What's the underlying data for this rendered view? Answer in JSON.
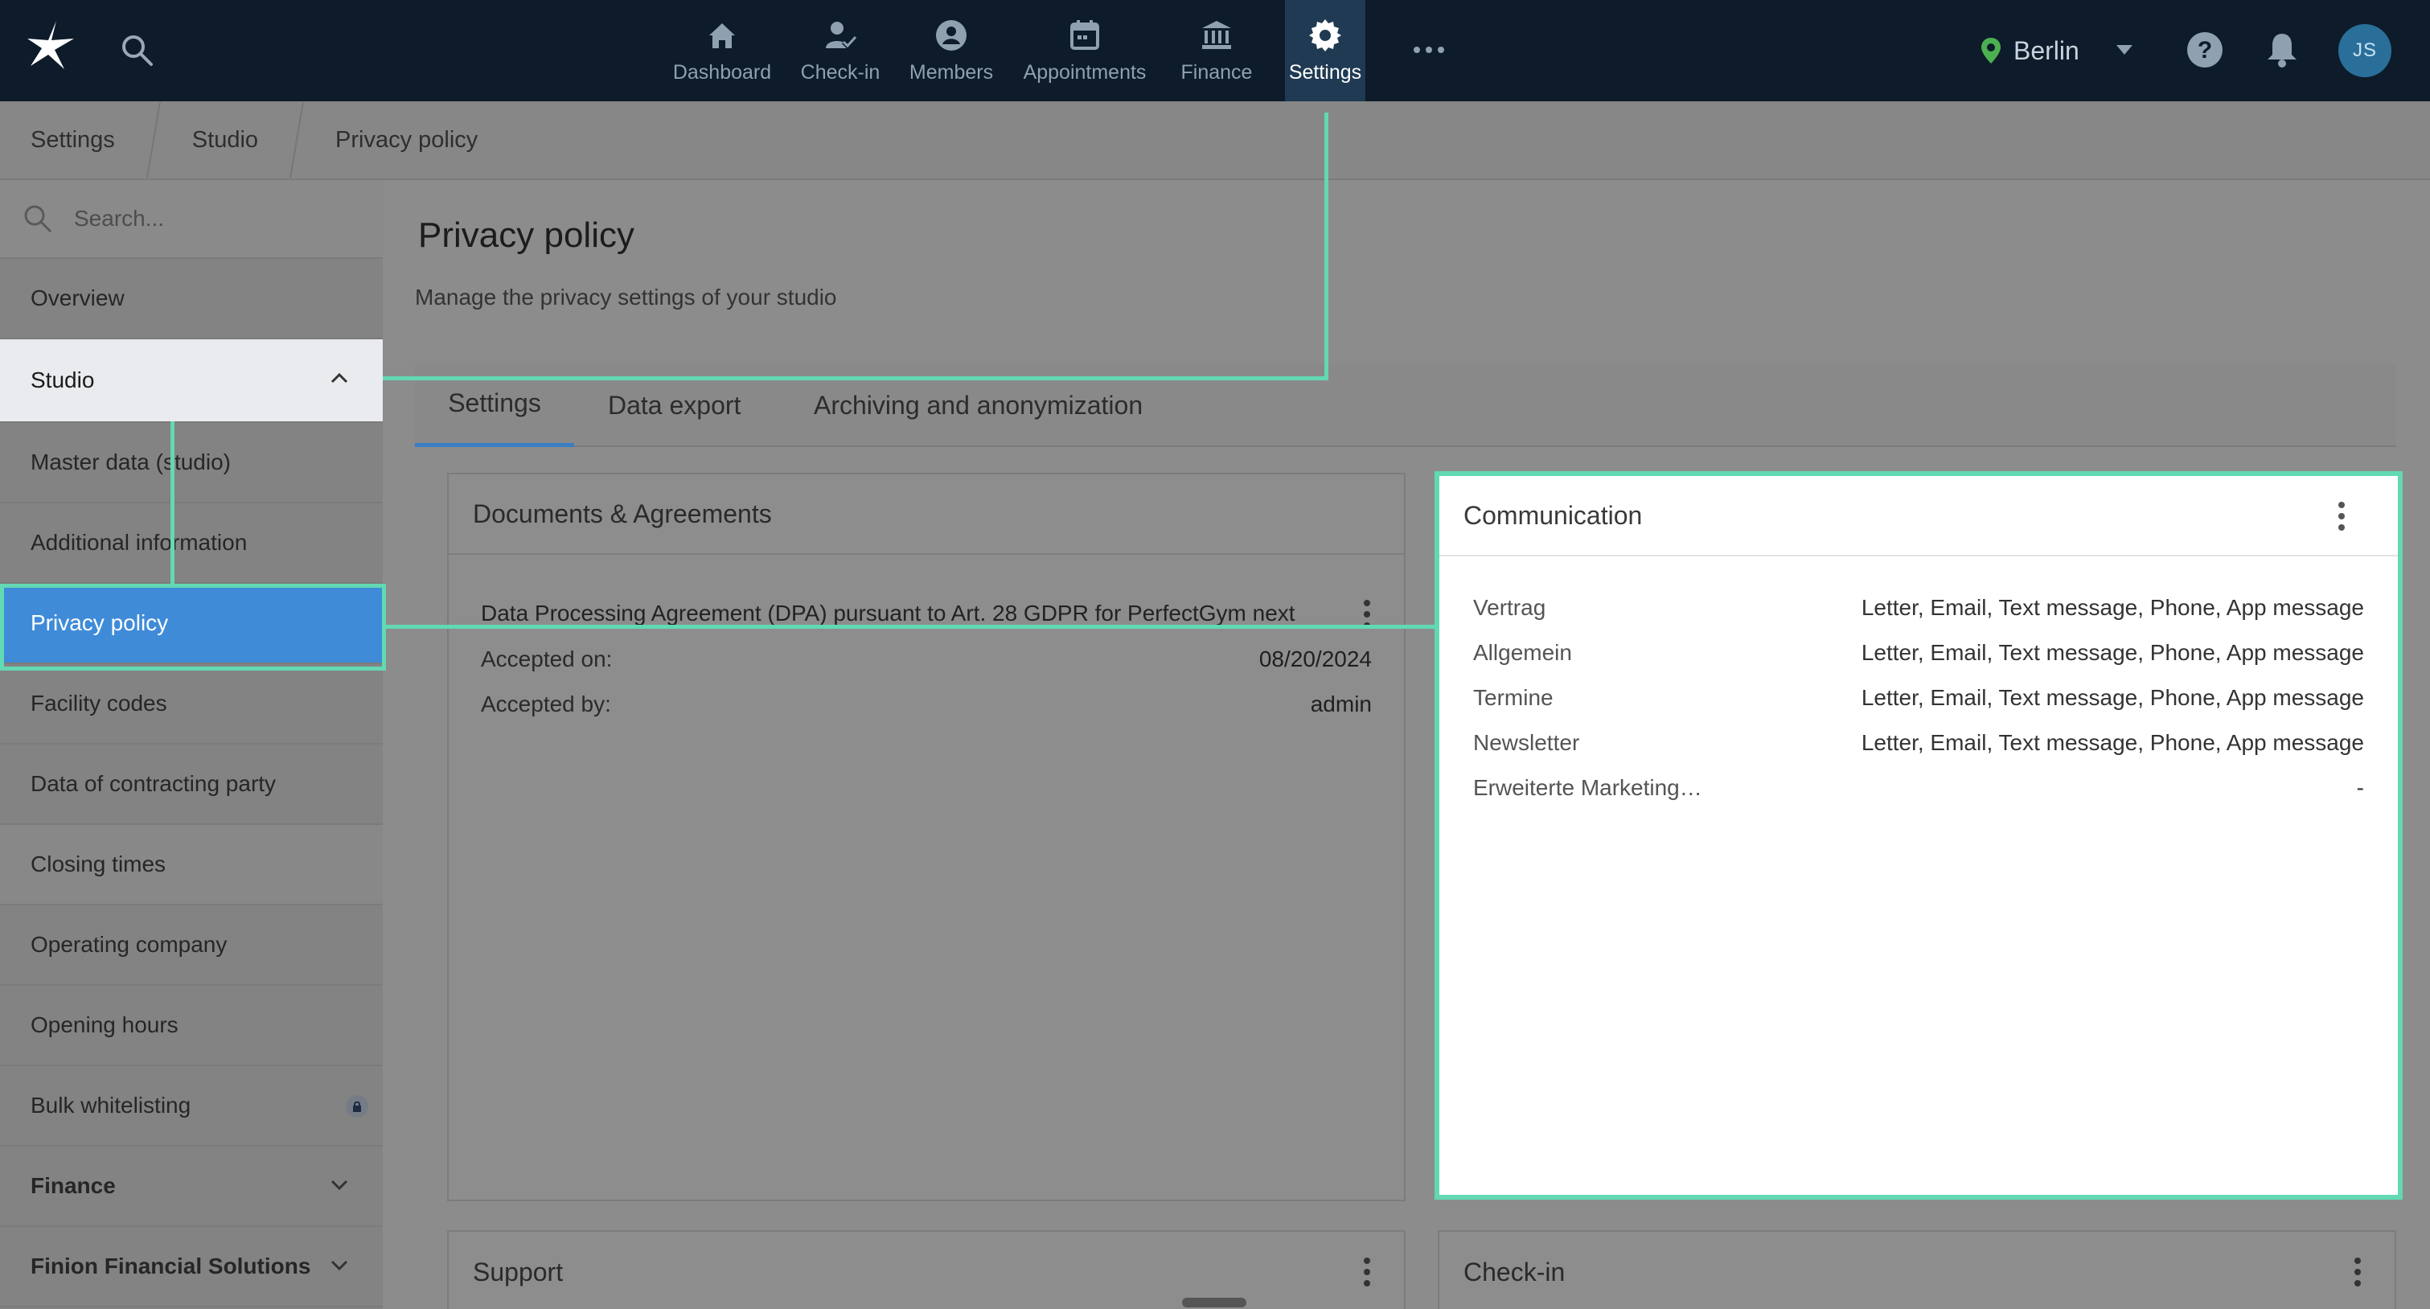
{
  "topbar": {
    "nav": [
      {
        "label": "Dashboard",
        "icon": "home-icon"
      },
      {
        "label": "Check-in",
        "icon": "user-check-icon"
      },
      {
        "label": "Members",
        "icon": "user-circle-icon"
      },
      {
        "label": "Appointments",
        "icon": "calendar-icon"
      },
      {
        "label": "Finance",
        "icon": "bank-icon"
      },
      {
        "label": "Settings",
        "icon": "gear-icon",
        "active": true
      }
    ],
    "location": "Berlin",
    "avatar_initials": "JS",
    "colors": {
      "background": "#0d1b2a",
      "active": "#1f3a52",
      "location_pin": "#4caf50"
    }
  },
  "breadcrumb": [
    "Settings",
    "Studio",
    "Privacy policy"
  ],
  "sidebar": {
    "search_placeholder": "Search...",
    "items": [
      {
        "label": "Overview"
      },
      {
        "label": "Studio",
        "expanded": true
      },
      {
        "label": "Master data (studio)"
      },
      {
        "label": "Additional information"
      },
      {
        "label": "Privacy policy",
        "selected": true
      },
      {
        "label": "Facility codes"
      },
      {
        "label": "Data of contracting party"
      },
      {
        "label": "Closing times"
      },
      {
        "label": "Operating company"
      },
      {
        "label": "Opening hours"
      },
      {
        "label": "Bulk whitelisting",
        "locked": true
      },
      {
        "label": "Finance",
        "collapsed": true
      },
      {
        "label": "Finion Financial Solutions",
        "collapsed": true
      }
    ]
  },
  "main": {
    "title": "Privacy policy",
    "subtitle": "Manage the privacy settings of your studio",
    "tabs": [
      {
        "label": "Settings",
        "active": true
      },
      {
        "label": "Data export"
      },
      {
        "label": "Archiving and anonymization"
      }
    ],
    "documents_card": {
      "title": "Documents & Agreements",
      "document_title": "Data Processing Agreement (DPA) pursuant to Art. 28 GDPR for PerfectGym next",
      "rows": [
        {
          "label": "Accepted on:",
          "value": "08/20/2024"
        },
        {
          "label": "Accepted by:",
          "value": "admin"
        }
      ]
    },
    "communication_card": {
      "title": "Communication",
      "rows": [
        {
          "label": "Vertrag",
          "value": "Letter, Email, Text message, Phone, App message"
        },
        {
          "label": "Allgemein",
          "value": "Letter, Email, Text message, Phone, App message"
        },
        {
          "label": "Termine",
          "value": "Letter, Email, Text message, Phone, App message"
        },
        {
          "label": "Newsletter",
          "value": "Letter, Email, Text message, Phone, App message"
        },
        {
          "label": "Erweiterte Marketing…",
          "value": "-"
        }
      ]
    },
    "support_card": {
      "title": "Support"
    },
    "checkin_card": {
      "title": "Check-in"
    }
  },
  "annotation_color": "#62d8b3"
}
